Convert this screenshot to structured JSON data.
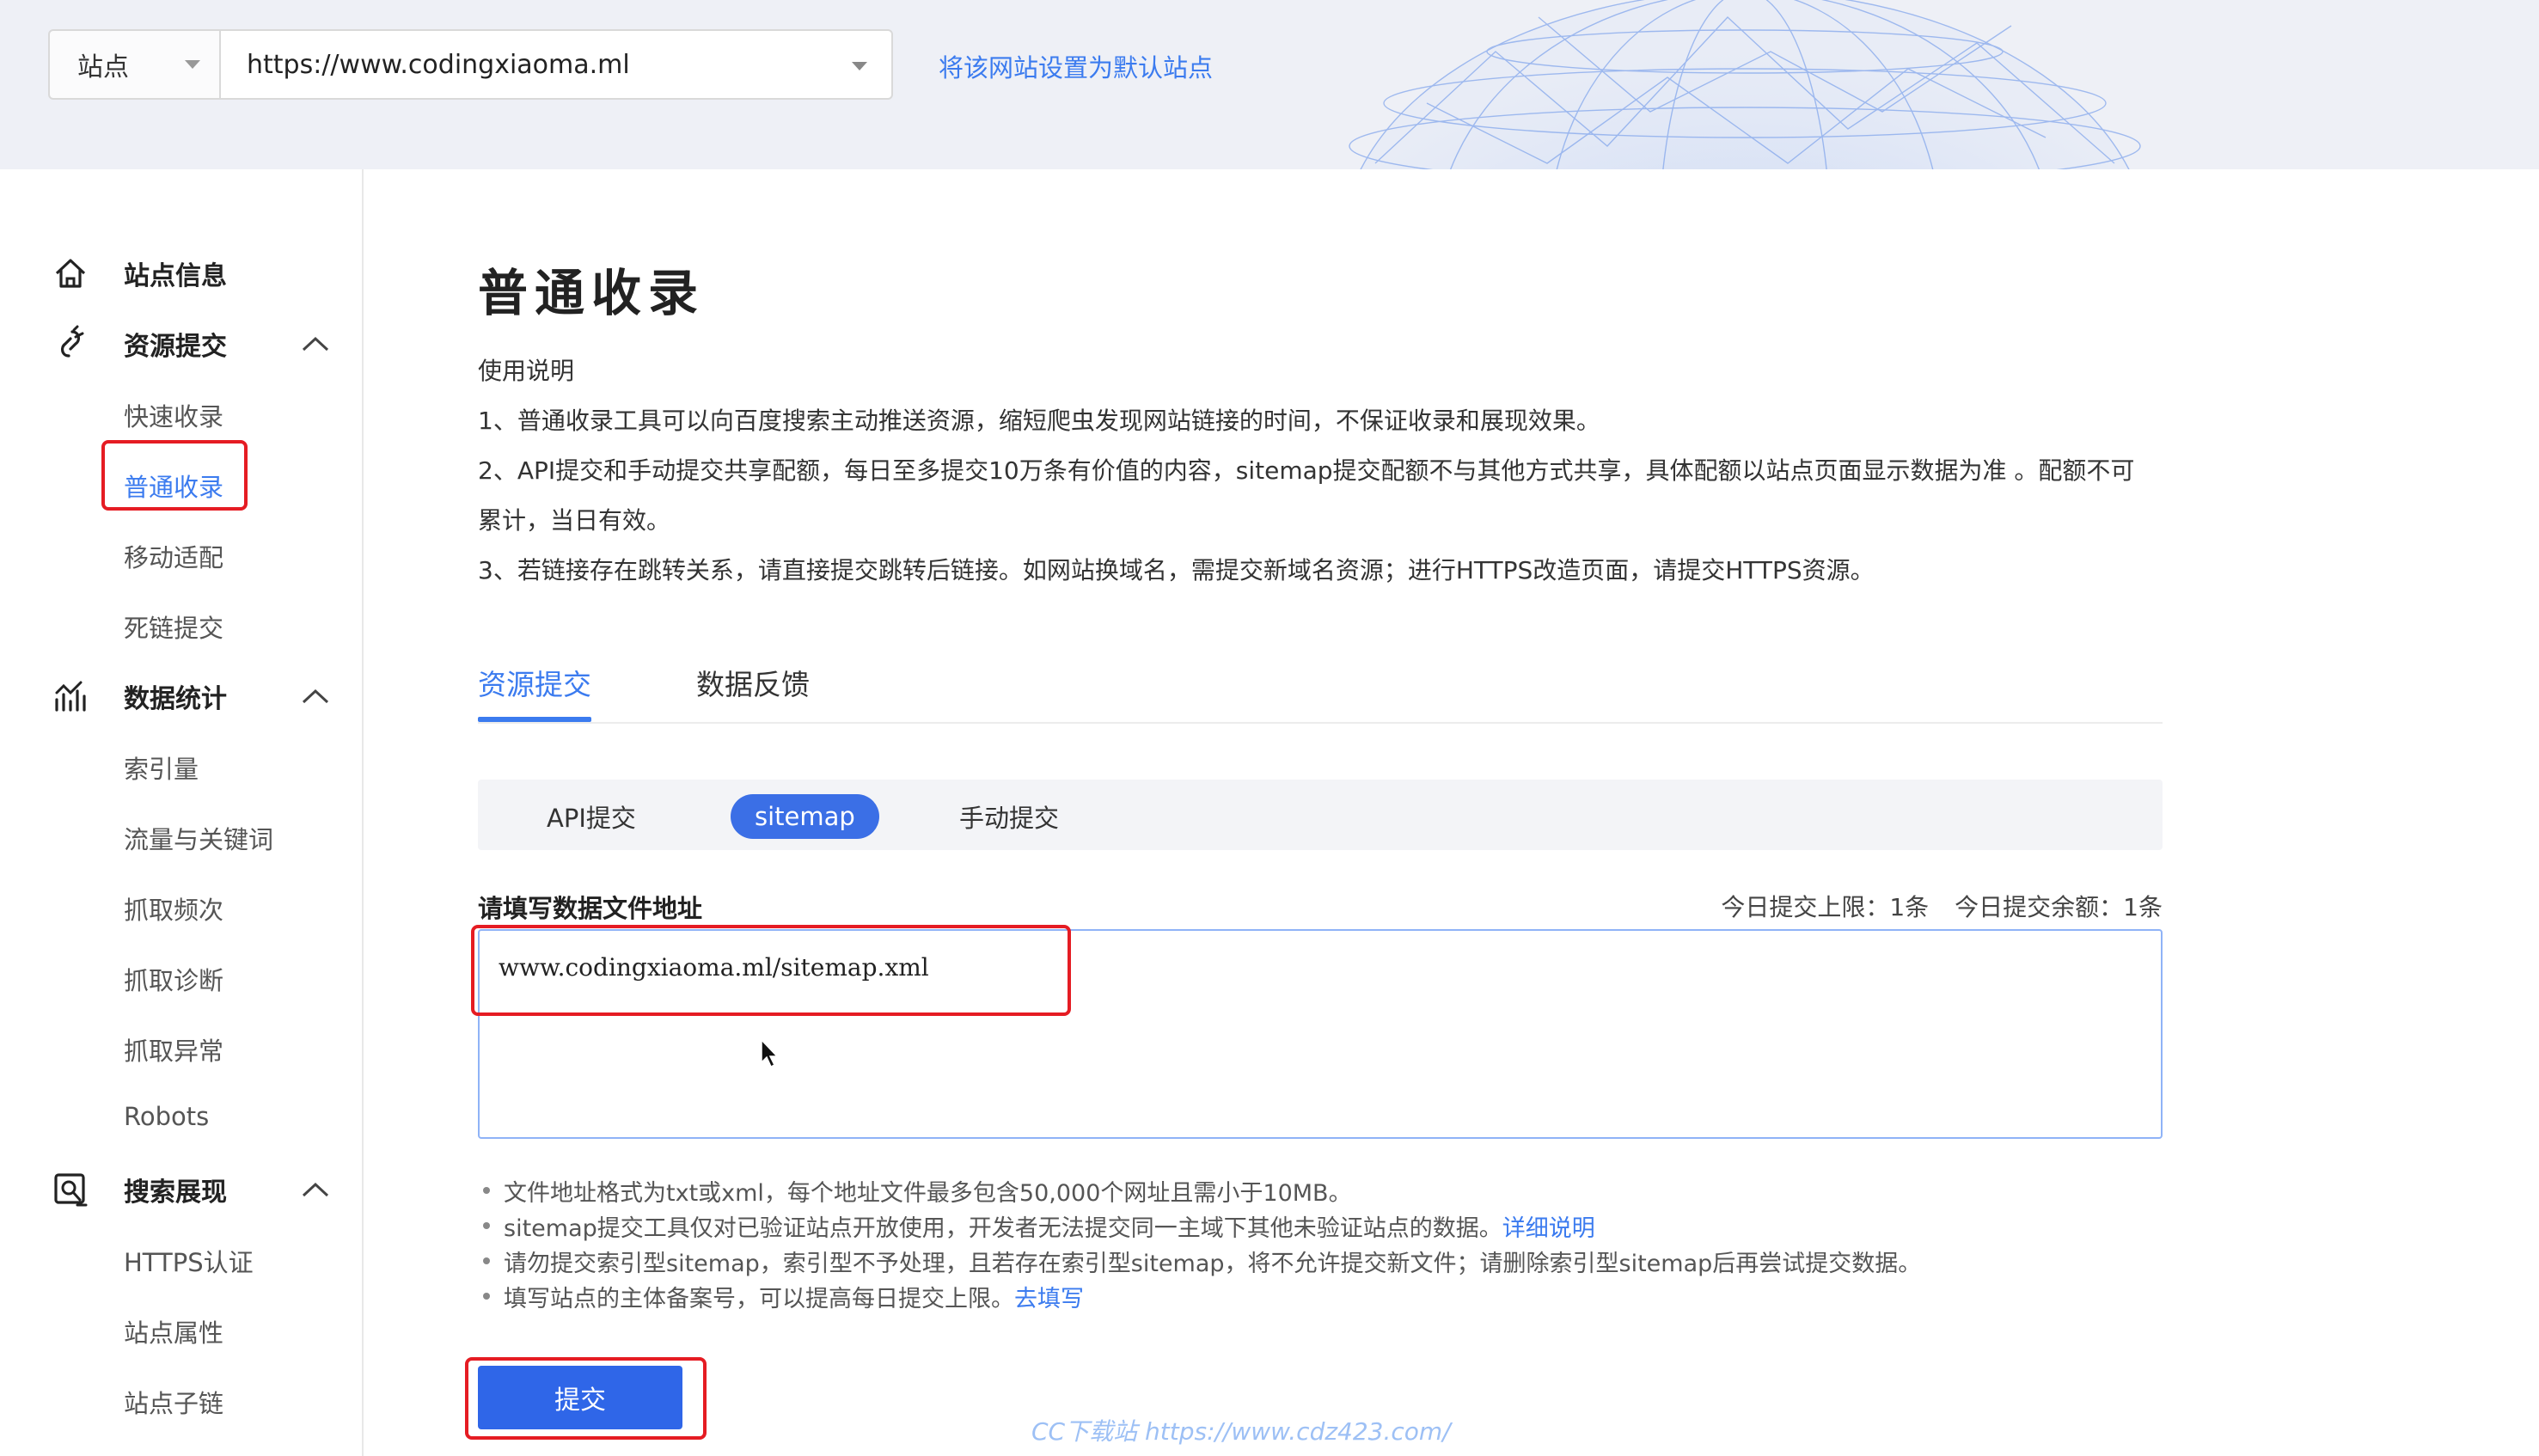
{
  "header": {
    "site_label": "站点",
    "site_url": "https://www.codingxiaoma.ml",
    "set_default_link": "将该网站设置为默认站点"
  },
  "sidebar": {
    "groups": [
      {
        "label": "站点信息",
        "icon": "home-icon"
      },
      {
        "label": "资源提交",
        "icon": "link-icon",
        "items": [
          "快速收录",
          "普通收录",
          "移动适配",
          "死链提交"
        ]
      },
      {
        "label": "数据统计",
        "icon": "chart-icon",
        "items": [
          "索引量",
          "流量与关键词",
          "抓取频次",
          "抓取诊断",
          "抓取异常",
          "Robots"
        ]
      },
      {
        "label": "搜索展现",
        "icon": "search-display-icon",
        "items": [
          "HTTPS认证",
          "站点属性",
          "站点子链"
        ]
      }
    ],
    "active_item": "普通收录"
  },
  "main": {
    "title": "普通收录",
    "usage_title": "使用说明",
    "usage_lines": [
      "1、普通收录工具可以向百度搜索主动推送资源，缩短爬虫发现网站链接的时间，不保证收录和展现效果。",
      "2、API提交和手动提交共享配额，每日至多提交10万条有价值的内容，sitemap提交配额不与其他方式共享，具体配额以站点页面显示数据为准 。配额不可",
      "累计，当日有效。",
      "3、若链接存在跳转关系，请直接提交跳转后链接。如网站换域名，需提交新域名资源；进行HTTPS改造页面，请提交HTTPS资源。"
    ],
    "tabs": [
      "资源提交",
      "数据反馈"
    ],
    "methods": [
      "API提交",
      "sitemap",
      "手动提交"
    ],
    "field_label": "请填写数据文件地址",
    "quota_limit": "今日提交上限：1条",
    "quota_remaining": "今日提交余额：1条",
    "textarea_value": "www.codingxiaoma.ml/sitemap.xml",
    "notes": {
      "n1": "文件地址格式为txt或xml，每个地址文件最多包含50,000个网址且需小于10MB。",
      "n2": "sitemap提交工具仅对已验证站点开放使用，开发者无法提交同一主域下其他未验证站点的数据。",
      "n2_link": "详细说明",
      "n3": "请勿提交索引型sitemap，索引型不予处理，且若存在索引型sitemap，将不允许提交新文件；请删除索引型sitemap后再尝试提交数据。",
      "n4": "填写站点的主体备案号，可以提高每日提交上限。",
      "n4_link": "去填写"
    },
    "submit_label": "提交"
  },
  "watermark": "CC下载站  https://www.cdz423.com/",
  "colors": {
    "accent": "#3b7bef",
    "button": "#2f66e8",
    "highlight": "#e51c23"
  }
}
